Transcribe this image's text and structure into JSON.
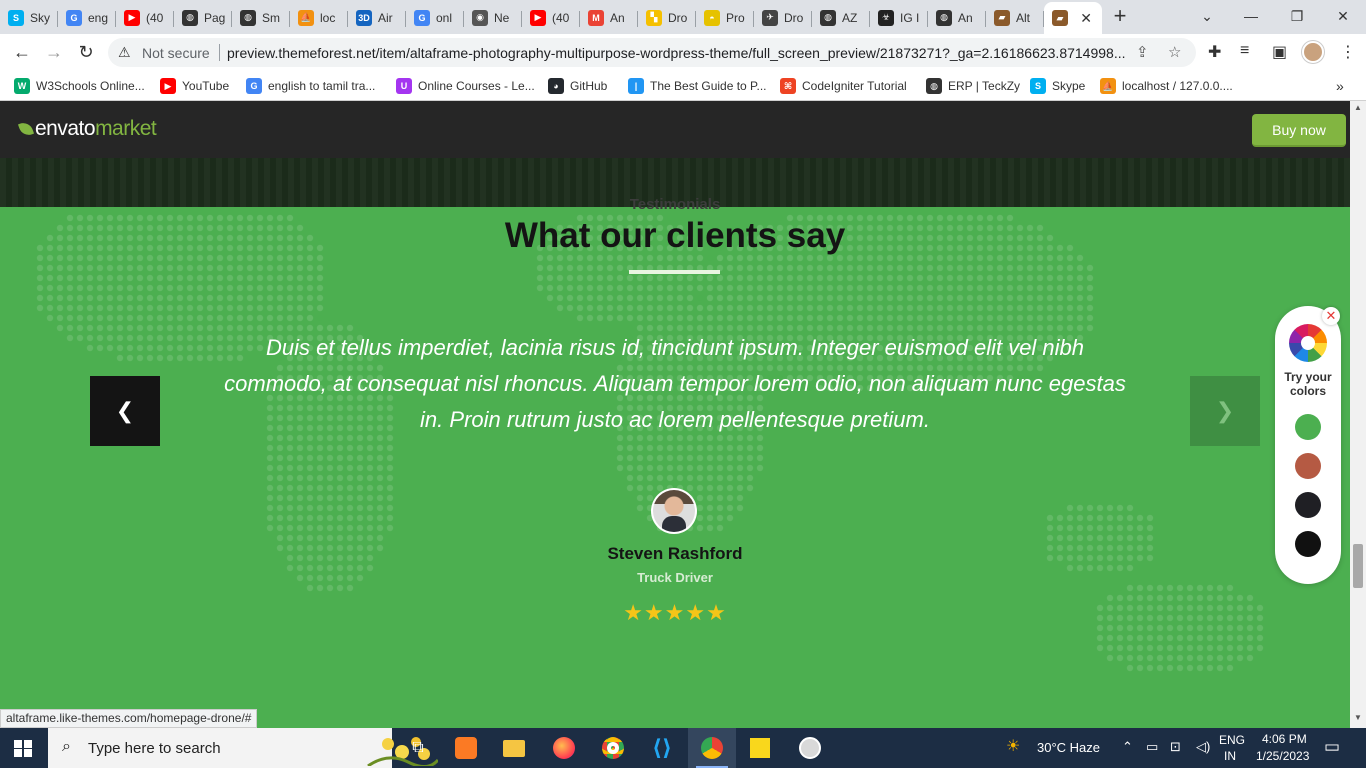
{
  "browser": {
    "tabs": [
      {
        "label": "Sky",
        "icon": "skype-icon",
        "color": "#00aff0",
        "glyph": "S"
      },
      {
        "label": "eng",
        "icon": "google-icon",
        "color": "#4285f4",
        "glyph": "G"
      },
      {
        "label": "(40",
        "icon": "youtube-icon",
        "color": "#ff0000",
        "glyph": "▶"
      },
      {
        "label": "Pag",
        "icon": "globe-icon",
        "color": "#333333",
        "glyph": "◍"
      },
      {
        "label": "Sm",
        "icon": "globe-icon",
        "color": "#333333",
        "glyph": "◍"
      },
      {
        "label": "loc",
        "icon": "phpmyadmin-icon",
        "color": "#f29111",
        "glyph": "⛵"
      },
      {
        "label": "Air",
        "icon": "3d-icon",
        "color": "#1565c0",
        "glyph": "3D"
      },
      {
        "label": "onl",
        "icon": "google-icon",
        "color": "#4285f4",
        "glyph": "G"
      },
      {
        "label": "Ne",
        "icon": "chrome-icon",
        "color": "#555555",
        "glyph": "◉"
      },
      {
        "label": "(40",
        "icon": "youtube-icon",
        "color": "#ff0000",
        "glyph": "▶"
      },
      {
        "label": "An",
        "icon": "gmail-icon",
        "color": "#ea4335",
        "glyph": "M"
      },
      {
        "label": "Dro",
        "icon": "drone-icon",
        "color": "#f5c000",
        "glyph": "▚"
      },
      {
        "label": "Pro",
        "icon": "yellow-icon",
        "color": "#e6c200",
        "glyph": "◓"
      },
      {
        "label": "Dro",
        "icon": "drone-icon",
        "color": "#444444",
        "glyph": "✈"
      },
      {
        "label": "AZ",
        "icon": "globe-icon",
        "color": "#333333",
        "glyph": "◍"
      },
      {
        "label": "IG I",
        "icon": "ig-icon",
        "color": "#222222",
        "glyph": "☣"
      },
      {
        "label": "An",
        "icon": "globe-icon",
        "color": "#333333",
        "glyph": "◍"
      },
      {
        "label": "Alt",
        "icon": "altaframe-icon",
        "color": "#8b5a2b",
        "glyph": "▰"
      }
    ],
    "active_tab_icon": "altaframe-icon",
    "address": {
      "security_label": "Not secure",
      "url": "preview.themeforest.net/item/altaframe-photography-multipurpose-wordpress-theme/full_screen_preview/21873271?_ga=2.16186623.8714998..."
    },
    "bookmarks": [
      {
        "label": "W3Schools Online...",
        "icon": "w3schools-icon",
        "color": "#04aa6d",
        "glyph": "W"
      },
      {
        "label": "YouTube",
        "icon": "youtube-icon",
        "color": "#ff0000",
        "glyph": "▶"
      },
      {
        "label": "english to tamil tra...",
        "icon": "google-icon",
        "color": "#4285f4",
        "glyph": "G"
      },
      {
        "label": "Online Courses - Le...",
        "icon": "udemy-icon",
        "color": "#a435f0",
        "glyph": "U"
      },
      {
        "label": "GitHub",
        "icon": "github-icon",
        "color": "#24292f",
        "glyph": "◕"
      },
      {
        "label": "The Best Guide to P...",
        "icon": "pin-icon",
        "color": "#2196f3",
        "glyph": "|"
      },
      {
        "label": "CodeIgniter Tutorial",
        "icon": "codeigniter-icon",
        "color": "#ee4323",
        "glyph": "⌘"
      },
      {
        "label": "ERP | TeckZy",
        "icon": "globe-icon",
        "color": "#333333",
        "glyph": "◍"
      },
      {
        "label": "Skype",
        "icon": "skype-icon",
        "color": "#00aff0",
        "glyph": "S"
      },
      {
        "label": "localhost / 127.0.0....",
        "icon": "phpmyadmin-icon",
        "color": "#f29111",
        "glyph": "⛵"
      }
    ]
  },
  "envato": {
    "logo_word1": "envato",
    "logo_word2": "market",
    "buy_label": "Buy now"
  },
  "testimonial": {
    "eyebrow": "Testimonials",
    "heading": "What our clients say",
    "quote": "Duis et tellus imperdiet, lacinia risus id, tincidunt ipsum. Integer euismod elit vel nibh commodo, at consequat nisl rhoncus. Aliquam tempor lorem odio, non aliquam nunc egestas in. Proin rutrum justo ac lorem pellentesque pretium.",
    "prev_icon": "chevron-left-icon",
    "next_icon": "chevron-right-icon",
    "author": "Steven Rashford",
    "role": "Truck Driver",
    "rating": 5,
    "stars": "★★★★★"
  },
  "color_picker": {
    "label": "Try your colors",
    "close_icon": "close-icon",
    "swatches": [
      "#4caf50",
      "#b55a43",
      "#1f1f24",
      "#111111"
    ]
  },
  "status_link": "altaframe.like-themes.com/homepage-drone/#",
  "taskbar": {
    "search_placeholder": "Type here to search",
    "weather": "30°C  Haze",
    "lang_top": "ENG",
    "lang_bottom": "IN",
    "time": "4:06 PM",
    "date": "1/25/2023"
  },
  "colors": {
    "page_green": "#4caf50",
    "envato_green": "#82b541",
    "star": "#f5c518"
  }
}
